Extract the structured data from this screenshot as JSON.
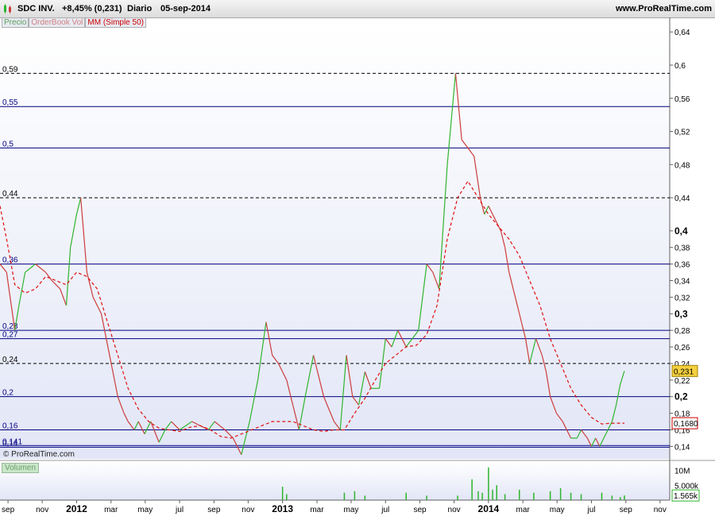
{
  "header": {
    "symbol": "SDC INV.",
    "change": "+8,45% (0,231)",
    "period": "Diario",
    "date": "05-sep-2014",
    "site": "www.ProRealTime.com"
  },
  "legend": {
    "price": "Precio",
    "orderbook": "OrderBook Vol",
    "ma": "MM (Simple 50)"
  },
  "copyright": "© ProRealTime.com",
  "volume_label": "Volumen",
  "colors": {
    "up": "#2fb42f",
    "down": "#cc3c3c",
    "ma": "#e01010",
    "hline": "#000080",
    "bg_top": "#ffffff",
    "bg_bottom": "#e2e6f6"
  },
  "chart_data": [
    {
      "type": "line",
      "ylim": [
        0.125,
        0.645
      ],
      "y_ticks": [
        "0,64",
        "0,6",
        "0,56",
        "0,52",
        "0,48",
        "0,44",
        "0,4",
        "0,38",
        "0,36",
        "0,34",
        "0,32",
        "0,3",
        "0,28",
        "0,26",
        "0,24",
        "0,22",
        "0,2",
        "0,18",
        "0,16",
        "0,14"
      ],
      "y_ticks_values": [
        0.64,
        0.6,
        0.56,
        0.52,
        0.48,
        0.44,
        0.4,
        0.38,
        0.36,
        0.34,
        0.32,
        0.3,
        0.28,
        0.26,
        0.24,
        0.22,
        0.2,
        0.18,
        0.16,
        0.14
      ],
      "y_ticks_bold": [
        "0,4",
        "0,3",
        "0,2"
      ],
      "x_ticks": [
        "sep",
        "nov",
        "2012",
        "mar",
        "may",
        "jul",
        "sep",
        "nov",
        "2013",
        "mar",
        "may",
        "jul",
        "sep",
        "nov",
        "2014",
        "mar",
        "may",
        "jul",
        "sep",
        "nov"
      ],
      "x_ticks_pos": [
        2011.667,
        2011.833,
        2012.0,
        2012.167,
        2012.333,
        2012.5,
        2012.667,
        2012.833,
        2013.0,
        2013.167,
        2013.333,
        2013.5,
        2013.667,
        2013.833,
        2014.0,
        2014.167,
        2014.333,
        2014.5,
        2014.667,
        2014.833
      ],
      "x_ticks_bold": [
        "2012",
        "2013",
        "2014"
      ],
      "xlim": [
        2011.628,
        2014.88
      ],
      "horizontal_lines": [
        {
          "label": "0,59",
          "value": 0.59,
          "style": "dashed"
        },
        {
          "label": "0,55",
          "value": 0.55,
          "style": "solid"
        },
        {
          "label": "0,5",
          "value": 0.5,
          "style": "solid"
        },
        {
          "label": "0,44",
          "value": 0.44,
          "style": "dashed"
        },
        {
          "label": "0,36",
          "value": 0.36,
          "style": "solid"
        },
        {
          "label": "0,28",
          "value": 0.28,
          "style": "solid"
        },
        {
          "label": "0,27",
          "value": 0.27,
          "style": "solid"
        },
        {
          "label": "0,24",
          "value": 0.24,
          "style": "dashed"
        },
        {
          "label": "0,2",
          "value": 0.2,
          "style": "solid"
        },
        {
          "label": "0,16",
          "value": 0.16,
          "style": "solid"
        },
        {
          "label": "0,141",
          "value": 0.141,
          "style": "solid"
        },
        {
          "label": "0,14",
          "value": 0.139,
          "style": "solid"
        }
      ],
      "price_label": "0,231",
      "price_value": 0.231,
      "ma_label": "0,1680",
      "ma_value": 0.168,
      "price_series": {
        "x": [
          2011.628,
          2011.66,
          2011.7,
          2011.72,
          2011.75,
          2011.8,
          2011.85,
          2011.88,
          2011.92,
          2011.95,
          2011.97,
          2012.0,
          2012.02,
          2012.05,
          2012.08,
          2012.12,
          2012.16,
          2012.2,
          2012.23,
          2012.25,
          2012.28,
          2012.3,
          2012.33,
          2012.36,
          2012.4,
          2012.43,
          2012.46,
          2012.5,
          2012.53,
          2012.56,
          2012.6,
          2012.64,
          2012.67,
          2012.72,
          2012.76,
          2012.8,
          2012.84,
          2012.88,
          2012.92,
          2012.95,
          2012.98,
          2013.0,
          2013.02,
          2013.05,
          2013.08,
          2013.11,
          2013.15,
          2013.2,
          2013.25,
          2013.28,
          2013.31,
          2013.34,
          2013.37,
          2013.4,
          2013.43,
          2013.47,
          2013.5,
          2013.53,
          2013.56,
          2013.6,
          2013.63,
          2013.66,
          2013.7,
          2013.73,
          2013.76,
          2013.8,
          2013.84,
          2013.87,
          2013.9,
          2013.93,
          2013.96,
          2013.98,
          2014.0,
          2014.02,
          2014.04,
          2014.06,
          2014.08,
          2014.1,
          2014.12,
          2014.15,
          2014.18,
          2014.2,
          2014.23,
          2014.26,
          2014.28,
          2014.3,
          2014.33,
          2014.36,
          2014.38,
          2014.4,
          2014.43,
          2014.45,
          2014.48,
          2014.5,
          2014.52,
          2014.54,
          2014.56,
          2014.58,
          2014.6,
          2014.62,
          2014.64,
          2014.66
        ],
        "y": [
          0.36,
          0.35,
          0.28,
          0.31,
          0.35,
          0.36,
          0.35,
          0.34,
          0.33,
          0.31,
          0.38,
          0.42,
          0.44,
          0.35,
          0.32,
          0.3,
          0.25,
          0.2,
          0.18,
          0.17,
          0.16,
          0.17,
          0.155,
          0.17,
          0.145,
          0.16,
          0.17,
          0.16,
          0.165,
          0.17,
          0.165,
          0.16,
          0.17,
          0.16,
          0.15,
          0.13,
          0.17,
          0.22,
          0.29,
          0.25,
          0.24,
          0.23,
          0.22,
          0.19,
          0.16,
          0.2,
          0.25,
          0.2,
          0.17,
          0.16,
          0.25,
          0.2,
          0.19,
          0.23,
          0.21,
          0.21,
          0.27,
          0.26,
          0.28,
          0.26,
          0.27,
          0.28,
          0.36,
          0.35,
          0.33,
          0.48,
          0.59,
          0.51,
          0.5,
          0.49,
          0.44,
          0.42,
          0.43,
          0.42,
          0.41,
          0.4,
          0.38,
          0.35,
          0.33,
          0.3,
          0.27,
          0.24,
          0.27,
          0.25,
          0.23,
          0.2,
          0.18,
          0.17,
          0.16,
          0.15,
          0.15,
          0.16,
          0.15,
          0.14,
          0.15,
          0.14,
          0.15,
          0.16,
          0.17,
          0.19,
          0.215,
          0.231
        ]
      },
      "ma_series": {
        "x": [
          2011.628,
          2011.66,
          2011.7,
          2011.75,
          2011.8,
          2011.85,
          2011.9,
          2011.95,
          2012.0,
          2012.05,
          2012.1,
          2012.15,
          2012.2,
          2012.25,
          2012.3,
          2012.35,
          2012.4,
          2012.45,
          2012.5,
          2012.55,
          2012.6,
          2012.65,
          2012.7,
          2012.75,
          2012.8,
          2012.85,
          2012.9,
          2012.95,
          2013.0,
          2013.05,
          2013.1,
          2013.15,
          2013.2,
          2013.25,
          2013.3,
          2013.35,
          2013.4,
          2013.45,
          2013.5,
          2013.55,
          2013.6,
          2013.65,
          2013.7,
          2013.75,
          2013.8,
          2013.85,
          2013.9,
          2013.95,
          2014.0,
          2014.05,
          2014.1,
          2014.15,
          2014.2,
          2014.25,
          2014.3,
          2014.35,
          2014.4,
          2014.45,
          2014.5,
          2014.55,
          2014.6,
          2014.65,
          2014.66
        ],
        "y": [
          0.43,
          0.39,
          0.335,
          0.325,
          0.33,
          0.345,
          0.34,
          0.335,
          0.35,
          0.345,
          0.33,
          0.29,
          0.25,
          0.21,
          0.185,
          0.17,
          0.162,
          0.16,
          0.158,
          0.163,
          0.165,
          0.16,
          0.152,
          0.15,
          0.155,
          0.16,
          0.165,
          0.17,
          0.17,
          0.17,
          0.165,
          0.16,
          0.158,
          0.16,
          0.16,
          0.18,
          0.198,
          0.22,
          0.24,
          0.25,
          0.26,
          0.262,
          0.275,
          0.31,
          0.39,
          0.44,
          0.46,
          0.44,
          0.42,
          0.405,
          0.39,
          0.37,
          0.34,
          0.31,
          0.27,
          0.24,
          0.21,
          0.19,
          0.175,
          0.167,
          0.168,
          0.168,
          0.168
        ]
      }
    },
    {
      "type": "bar",
      "name": "Volumen",
      "y_ticks": [
        "10M",
        "5.000k"
      ],
      "y_ticks_values": [
        10000000,
        5000000
      ],
      "current_label": "1.565k",
      "current_value": 1565000,
      "ylim": [
        0,
        12000000
      ],
      "x": [
        2013.0,
        2013.02,
        2013.3,
        2013.35,
        2013.4,
        2013.6,
        2013.7,
        2013.85,
        2013.92,
        2013.95,
        2013.97,
        2014.0,
        2014.02,
        2014.04,
        2014.08,
        2014.15,
        2014.22,
        2014.3,
        2014.35,
        2014.4,
        2014.45,
        2014.55,
        2014.6,
        2014.64,
        2014.66
      ],
      "values": [
        4500000,
        2000000,
        2500000,
        3000000,
        1500000,
        2500000,
        1500000,
        1500000,
        7000000,
        3000000,
        2500000,
        11000000,
        3500000,
        5000000,
        2000000,
        3500000,
        2500000,
        3000000,
        4000000,
        2500000,
        2000000,
        2500000,
        1500000,
        1000000,
        1565000
      ]
    }
  ]
}
